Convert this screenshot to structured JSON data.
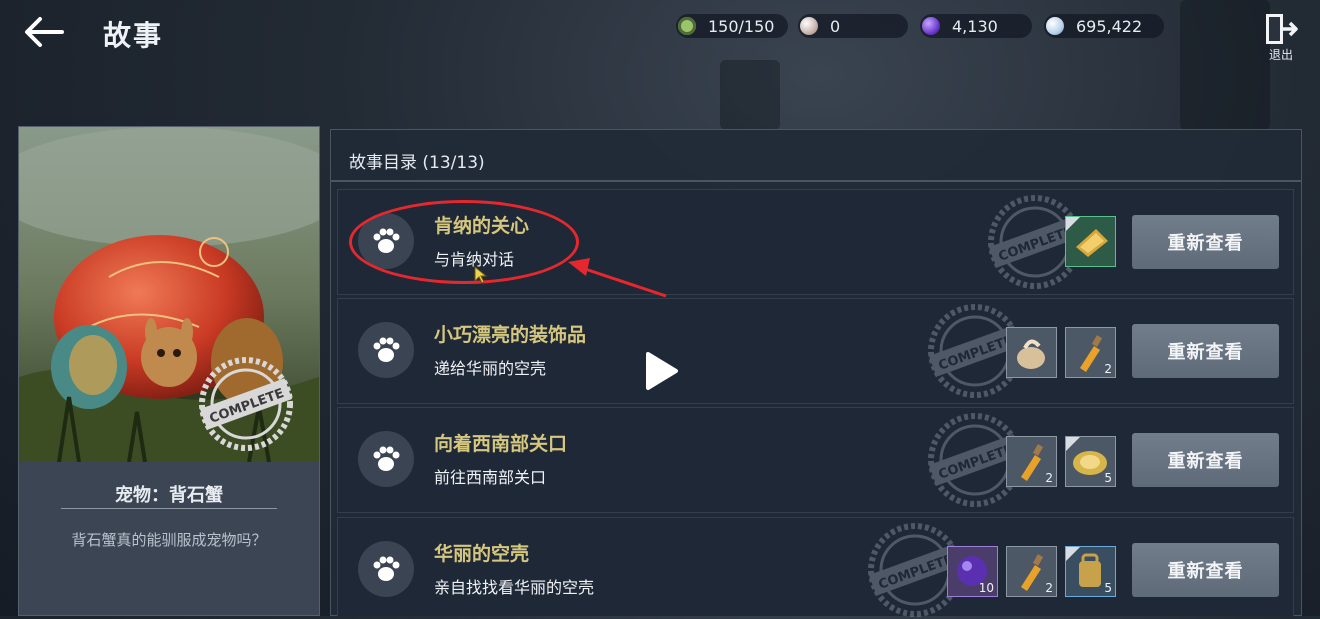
{
  "header": {
    "title": "故事",
    "resources": [
      {
        "icon": "stamina-icon",
        "value": "150/150",
        "color": "#9cc46a"
      },
      {
        "icon": "pearl-icon",
        "value": "0",
        "color": "#d9c9c4"
      },
      {
        "icon": "purple-gem-icon",
        "value": "4,130",
        "color": "#7b4fd0"
      },
      {
        "icon": "silver-coin-icon",
        "value": "695,422",
        "color": "#b8d2ea"
      }
    ],
    "exit_label": "退出"
  },
  "pet_card": {
    "name": "宠物：背石蟹",
    "description": "背石蟹真的能驯服成宠物吗？",
    "stamp_text": "COMPLETE"
  },
  "story_panel": {
    "header": "故事目录 (13/13)",
    "stamp_text": "COMPLETE",
    "rows": [
      {
        "title": "肯纳的关心",
        "subtitle": "与肯纳对话",
        "button": "重新查看",
        "rewards": [
          {
            "icon": "golden-gift-icon",
            "count": "",
            "frame": "green",
            "color": "#c99a2e"
          }
        ]
      },
      {
        "title": "小巧漂亮的装饰品",
        "subtitle": "递给华丽的空壳",
        "button": "重新查看",
        "rewards": [
          {
            "icon": "shell-ornament-icon",
            "count": "",
            "frame": "gray",
            "color": "#d8c09a"
          },
          {
            "icon": "potion-bottle-icon",
            "count": "2",
            "frame": "gray",
            "color": "#e8a22a"
          }
        ]
      },
      {
        "title": "向着西南部关口",
        "subtitle": "前往西南部关口",
        "button": "重新查看",
        "rewards": [
          {
            "icon": "potion-bottle-icon",
            "count": "2",
            "frame": "gray",
            "color": "#e8a22a"
          },
          {
            "icon": "golden-plate-icon",
            "count": "5",
            "frame": "gray",
            "color": "#d6b64a"
          }
        ]
      },
      {
        "title": "华丽的空壳",
        "subtitle": "亲自找找看华丽的空壳",
        "button": "重新查看",
        "rewards": [
          {
            "icon": "purple-orb-icon",
            "count": "10",
            "frame": "purple",
            "color": "#6a3cc0"
          },
          {
            "icon": "potion-bottle-icon",
            "count": "2",
            "frame": "gray",
            "color": "#e8a22a"
          },
          {
            "icon": "backpack-icon",
            "count": "5",
            "frame": "blue",
            "color": "#c8a24a"
          }
        ]
      }
    ]
  }
}
